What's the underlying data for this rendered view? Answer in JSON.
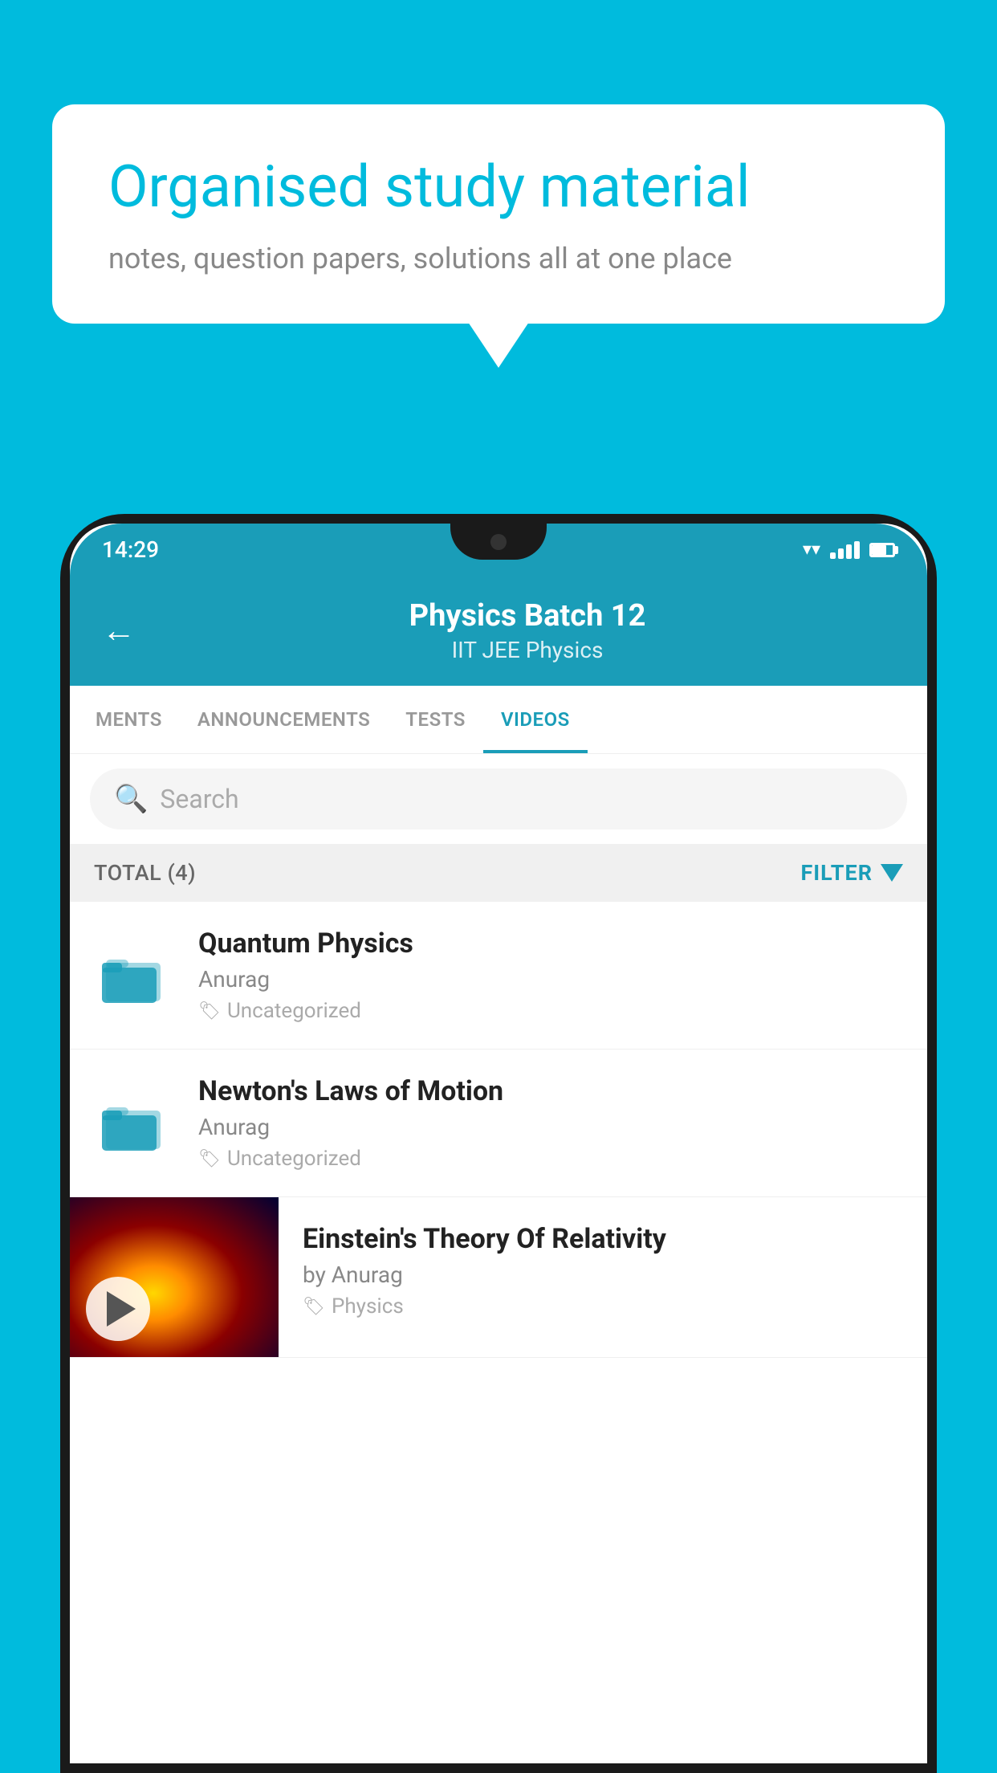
{
  "background_color": "#00BBDD",
  "speech_bubble": {
    "title": "Organised study material",
    "subtitle": "notes, question papers, solutions all at one place"
  },
  "phone": {
    "status_bar": {
      "time": "14:29"
    },
    "header": {
      "back_label": "←",
      "title": "Physics Batch 12",
      "subtitle": "IIT JEE   Physics"
    },
    "tabs": [
      {
        "label": "MENTS",
        "active": false
      },
      {
        "label": "ANNOUNCEMENTS",
        "active": false
      },
      {
        "label": "TESTS",
        "active": false
      },
      {
        "label": "VIDEOS",
        "active": true
      }
    ],
    "search": {
      "placeholder": "Search"
    },
    "filter_bar": {
      "total_label": "TOTAL (4)",
      "filter_label": "FILTER"
    },
    "video_items": [
      {
        "id": 1,
        "title": "Quantum Physics",
        "author": "Anurag",
        "tag": "Uncategorized",
        "has_thumb": false
      },
      {
        "id": 2,
        "title": "Newton's Laws of Motion",
        "author": "Anurag",
        "tag": "Uncategorized",
        "has_thumb": false
      },
      {
        "id": 3,
        "title": "Einstein's Theory Of Relativity",
        "author": "by Anurag",
        "tag": "Physics",
        "has_thumb": true
      }
    ]
  }
}
